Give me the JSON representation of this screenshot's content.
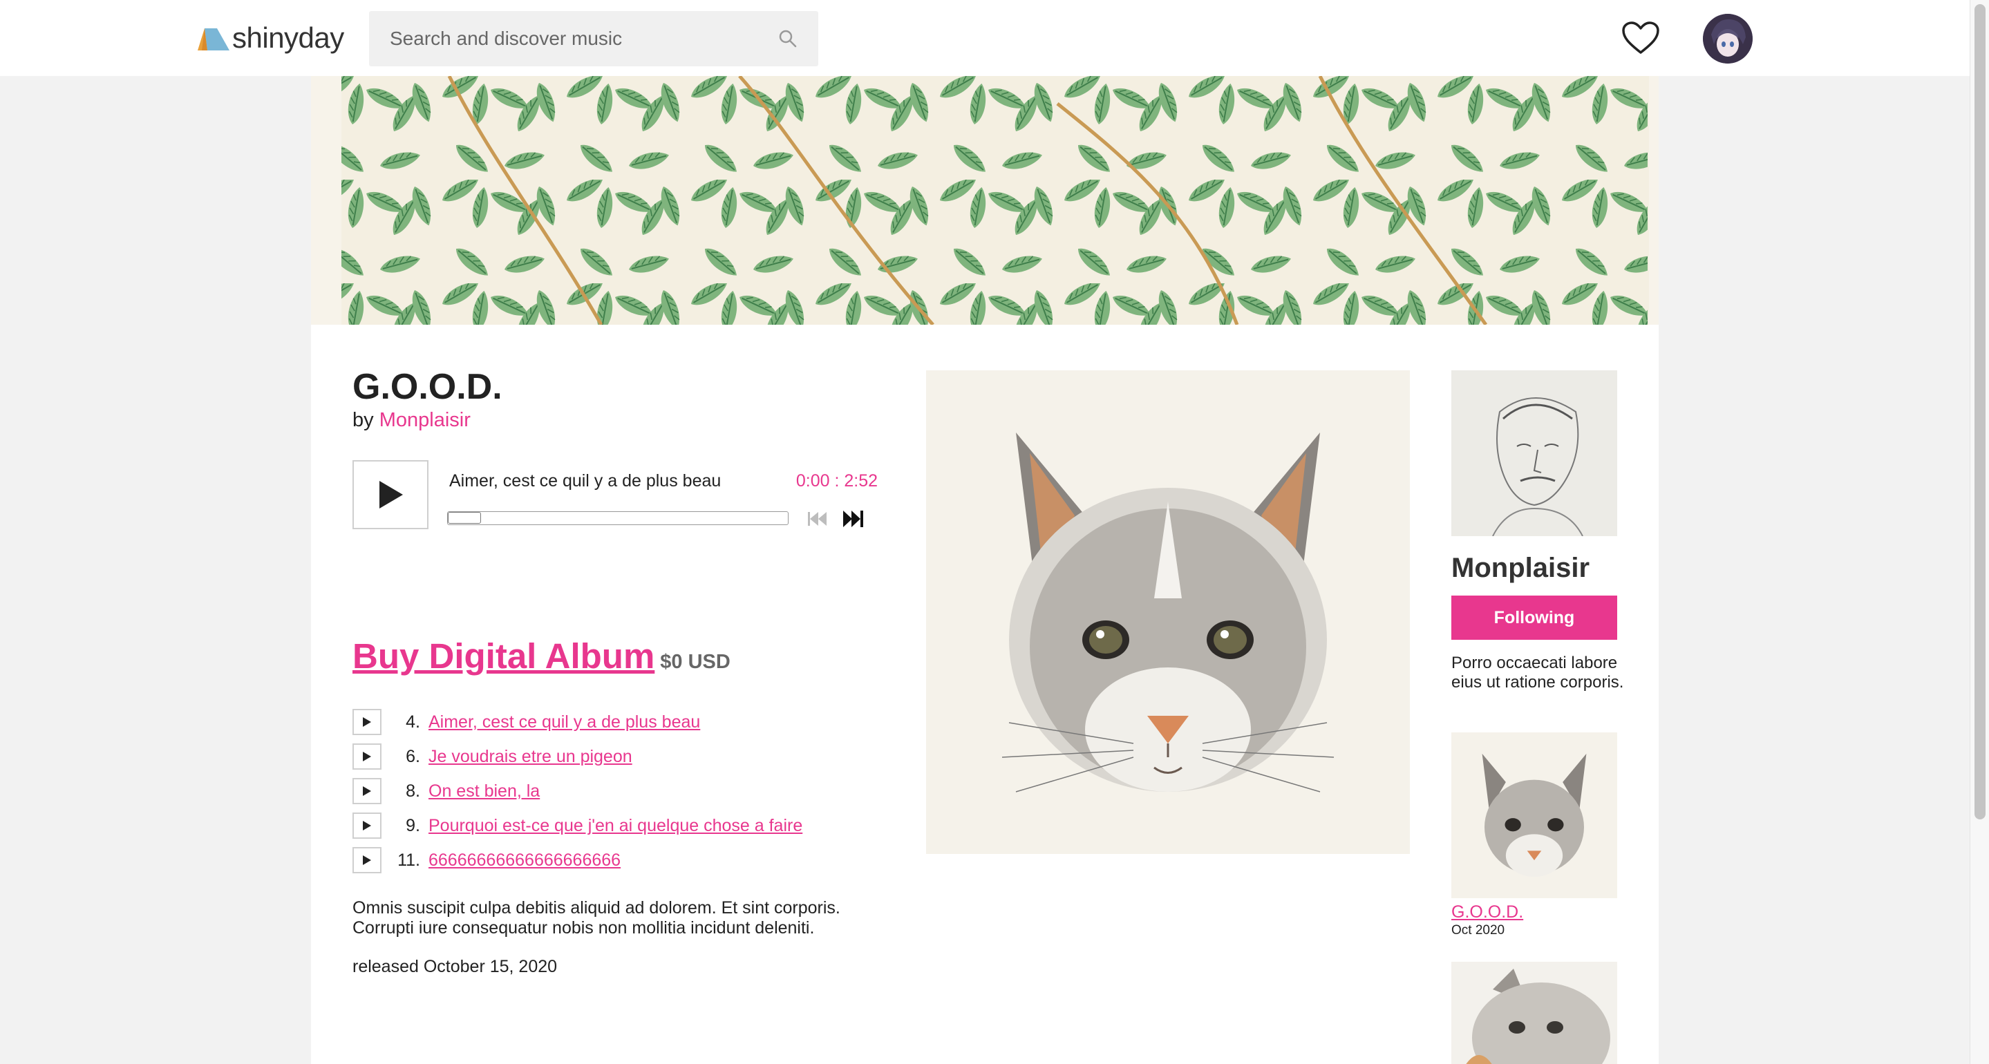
{
  "header": {
    "brand": "shinyday",
    "search_placeholder": "Search and discover music",
    "icons": {
      "logo": "shinyday-logo-icon",
      "search": "search-icon",
      "favorites": "heart-icon",
      "avatar": "user-avatar"
    }
  },
  "album": {
    "title": "G.O.O.D.",
    "by_label": "by",
    "artist": "Monplaisir",
    "player": {
      "current_track": "Aimer, cest ce quil y a de plus beau",
      "time": "0:00 : 2:52",
      "progress": 0
    },
    "buy": {
      "label": "Buy Digital Album",
      "price": "$0 USD"
    },
    "tracks": [
      {
        "number": "4.",
        "title": "Aimer, cest ce quil y a de plus beau"
      },
      {
        "number": "6.",
        "title": "Je voudrais etre un pigeon"
      },
      {
        "number": "8.",
        "title": "On est bien, la"
      },
      {
        "number": "9.",
        "title": "Pourquoi est-ce que j'en ai quelque chose a faire"
      },
      {
        "number": "11.",
        "title": "66666666666666666666"
      }
    ],
    "description": "Omnis suscipit culpa debitis aliquid ad dolorem. Et sint corporis. Corrupti iure consequatur nobis non mollitia incidunt deleniti.",
    "released": "released October 15, 2020"
  },
  "artist_panel": {
    "name": "Monplaisir",
    "follow_label": "Following",
    "bio": "Porro occaecati labore eius ut ratione corporis.",
    "discography": [
      {
        "title": "G.O.O.D.",
        "date": "Oct 2020"
      }
    ]
  },
  "colors": {
    "accent": "#e8378e",
    "text": "#222222",
    "background": "#f2f2f2"
  }
}
